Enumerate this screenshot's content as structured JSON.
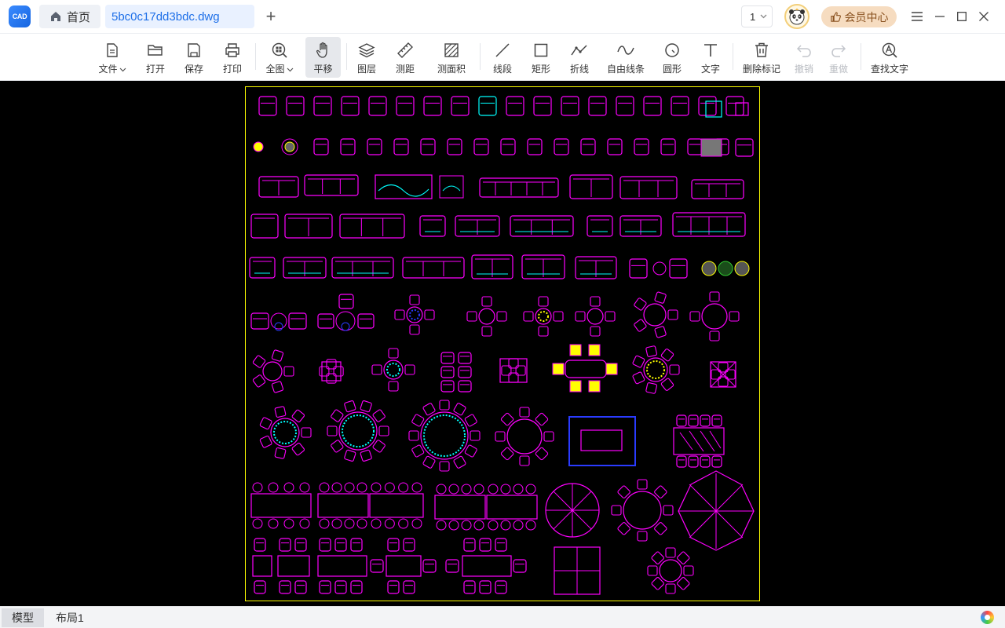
{
  "titlebar": {
    "logo_text": "CAD",
    "home_tab": "首页",
    "file_tab": "5bc0c17dd3bdc.dwg",
    "add_tab_symbol": "+",
    "page_number": "1",
    "vip_label": "会员中心"
  },
  "toolbar": {
    "items": [
      {
        "label": "文件",
        "icon": "file-icon",
        "dropdown": true
      },
      {
        "label": "打开",
        "icon": "folder-icon"
      },
      {
        "label": "保存",
        "icon": "save-icon"
      },
      {
        "label": "打印",
        "icon": "printer-icon"
      },
      {
        "label": "全图",
        "icon": "zoom-extents-icon",
        "dropdown": true
      },
      {
        "label": "平移",
        "icon": "hand-pan-icon",
        "active": true
      },
      {
        "label": "图层",
        "icon": "layers-icon"
      },
      {
        "label": "测距",
        "icon": "ruler-icon"
      },
      {
        "label": "测面积",
        "icon": "area-icon"
      },
      {
        "label": "线段",
        "icon": "line-icon"
      },
      {
        "label": "矩形",
        "icon": "rectangle-icon"
      },
      {
        "label": "折线",
        "icon": "polyline-icon"
      },
      {
        "label": "自由线条",
        "icon": "freehand-icon"
      },
      {
        "label": "圆形",
        "icon": "circle-icon"
      },
      {
        "label": "文字",
        "icon": "text-icon"
      },
      {
        "label": "删除标记",
        "icon": "trash-icon"
      },
      {
        "label": "撤销",
        "icon": "undo-icon",
        "disabled": true
      },
      {
        "label": "重做",
        "icon": "redo-icon",
        "disabled": true
      },
      {
        "label": "查找文字",
        "icon": "find-text-icon"
      }
    ]
  },
  "bottombar": {
    "tabs": [
      "模型",
      "布局1"
    ],
    "active_tab": "模型"
  },
  "colors": {
    "accent": "#1d6fe8",
    "canvas_bg": "#000000",
    "drawing_border": "#ffff00",
    "cad_magenta": "#ff00ff",
    "cad_cyan": "#00ffff",
    "cad_yellow": "#ffff00",
    "cad_blue": "#2a3bff"
  }
}
